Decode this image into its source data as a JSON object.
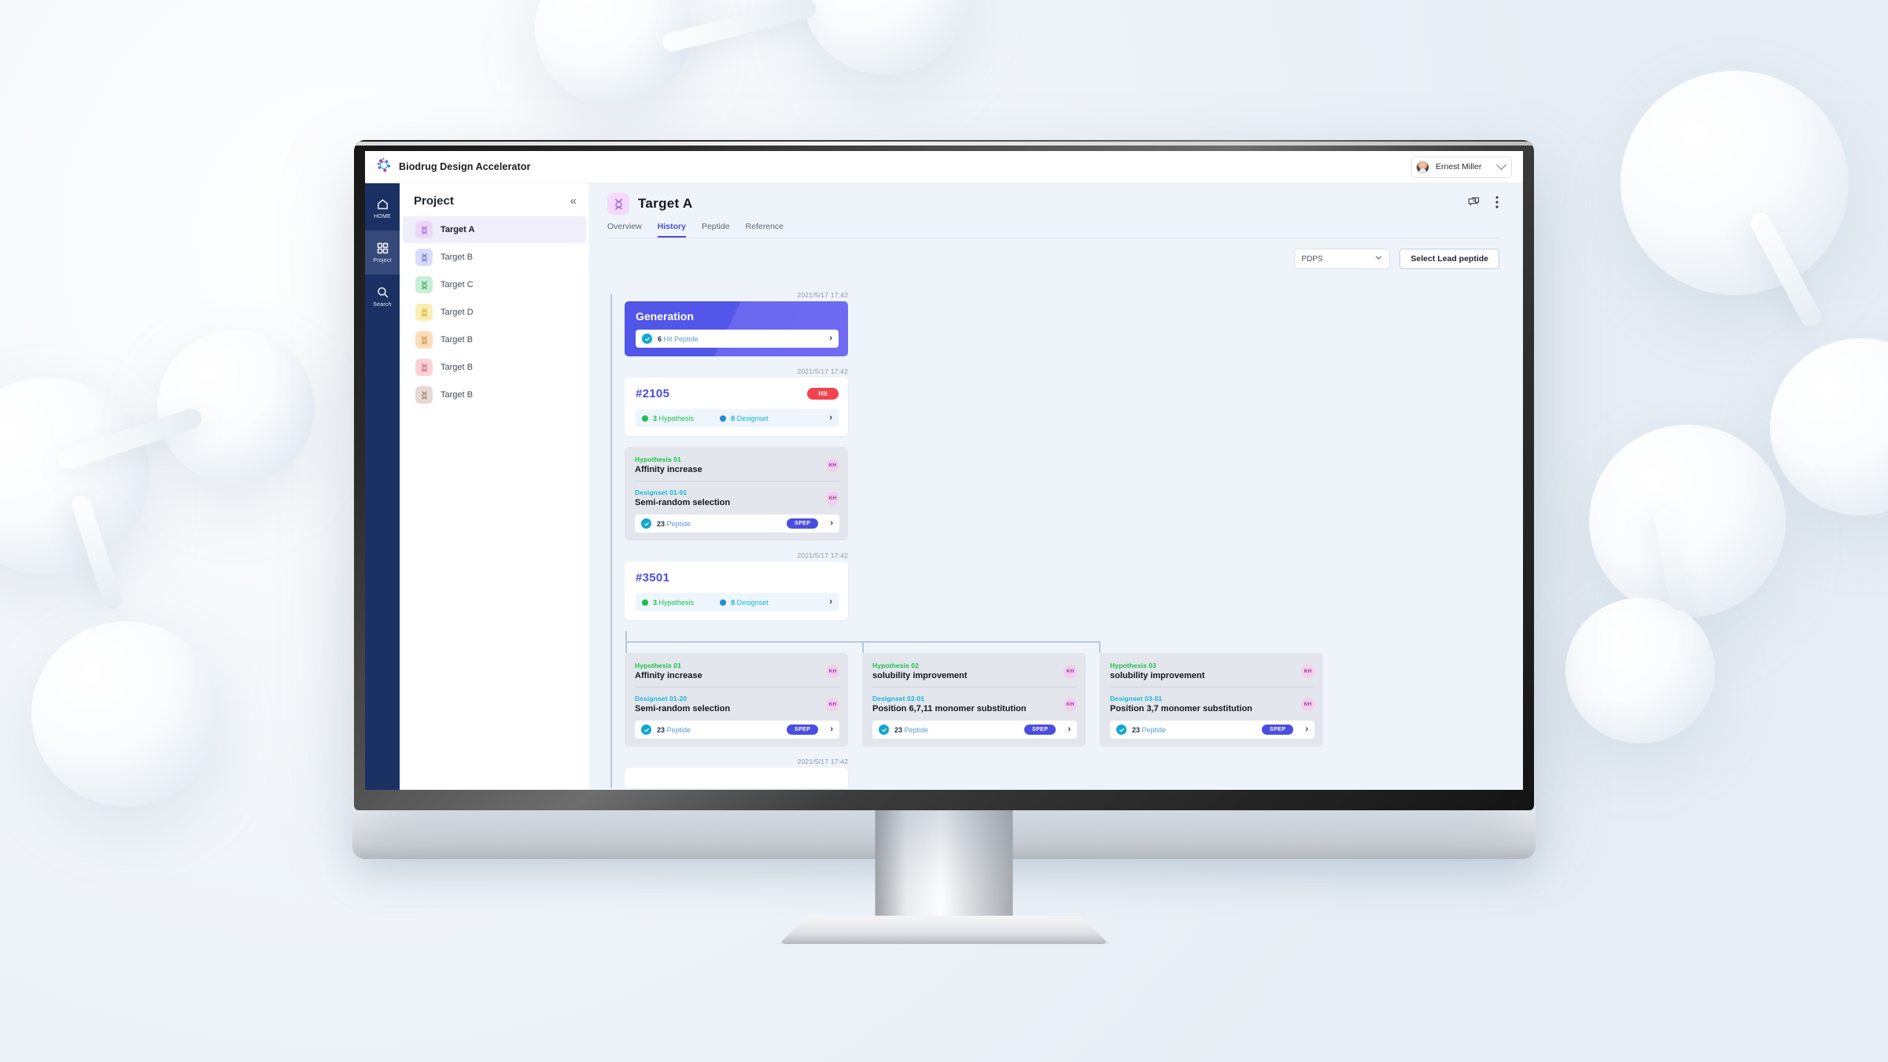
{
  "app": {
    "brand_name": "Biodrug Design Accelerator",
    "logo_icon": "molecule-logo-icon",
    "user": {
      "name": "Ernest Miller",
      "avatar_icon": "user-avatar",
      "caret_icon": "chevron-down-icon"
    }
  },
  "rail": {
    "items": [
      {
        "label": "HOME",
        "icon": "home-icon",
        "active": false
      },
      {
        "label": "Project",
        "icon": "grid-icon",
        "active": true
      },
      {
        "label": "Search",
        "icon": "search-icon",
        "active": false
      }
    ]
  },
  "projects": {
    "title": "Project",
    "collapse_icon": "chevrons-left-icon",
    "items": [
      {
        "label": "Target A",
        "color": "#edd6fb",
        "stroke": "#a765e0",
        "active": true
      },
      {
        "label": "Target B",
        "color": "#d9dcfb",
        "stroke": "#6b73dd",
        "active": false
      },
      {
        "label": "Target C",
        "color": "#c9f0d7",
        "stroke": "#3cab6a",
        "active": false
      },
      {
        "label": "Target D",
        "color": "#fbeeb4",
        "stroke": "#dfae2a",
        "active": false
      },
      {
        "label": "Target B",
        "color": "#fbddb9",
        "stroke": "#e08a38",
        "active": false
      },
      {
        "label": "Target B",
        "color": "#fbd2d8",
        "stroke": "#e0607a",
        "active": false
      },
      {
        "label": "Target B",
        "color": "#e8d9d3",
        "stroke": "#a58277",
        "active": false
      }
    ]
  },
  "header": {
    "target_title": "Target  A",
    "target_swatch_color": "#f4d9fb",
    "target_swatch_stroke": "#a765e0",
    "comment_icon": "comments-icon",
    "more_icon": "more-vertical-icon",
    "tabs": [
      {
        "label": "Overview",
        "active": false
      },
      {
        "label": "History",
        "active": true
      },
      {
        "label": "Peptide",
        "active": false
      },
      {
        "label": "Reference",
        "active": false
      }
    ]
  },
  "toolbar": {
    "select_value": "PDPS",
    "select_caret_icon": "chevron-down-icon",
    "lead_button": "Select Lead peptide"
  },
  "colors": {
    "accent": "#4a4ee0",
    "hit_badge": "#f1434e",
    "hypothesis_green": "#18c24a",
    "designset_cyan": "#16b6d8",
    "check_blue": "#11a7d1",
    "rail_navy": "#1b3163",
    "canvas": "#eef4fa"
  },
  "timeline": [
    {
      "kind": "generation",
      "timestamp": "2021/5/17  17:42",
      "title": "Generation",
      "peptide_count": "6",
      "peptide_label": "Hit Peptide",
      "check_icon": "check-circle-icon",
      "chevron_icon": "chevron-right-icon"
    },
    {
      "kind": "node",
      "timestamp": "2021/5/17  17:42",
      "number": "#2105",
      "badge": "Hit",
      "hypothesis_count": "3",
      "hypothesis_label": "Hypothesis",
      "designset_count": "8",
      "designset_label": "Designset",
      "chevron_icon": "chevron-right-icon"
    },
    {
      "kind": "hypothesis-card",
      "hypothesis_kicker": "Hypothesis 01",
      "hypothesis_name": "Affinity increase",
      "hypothesis_owner": "KH",
      "designset_kicker": "Designset 01-01",
      "designset_name": "Semi-random selection",
      "designset_owner": "KH",
      "peptide_count": "23",
      "peptide_label": "Peptide",
      "method_badge": "SPEP",
      "check_icon": "check-circle-icon",
      "chevron_icon": "chevron-right-icon"
    },
    {
      "kind": "node",
      "timestamp": "2021/5/17  17:42",
      "number": "#3501",
      "badge": "",
      "hypothesis_count": "3",
      "hypothesis_label": "Hypothesis",
      "designset_count": "8",
      "designset_label": "Designset",
      "chevron_icon": "chevron-right-icon"
    },
    {
      "kind": "branch-row",
      "cards": [
        {
          "hypothesis_kicker": "Hypothesis 01",
          "hypothesis_name": "Affinity increase",
          "hypothesis_owner": "KH",
          "designset_kicker": "Designset 01-20",
          "designset_name": "Semi-random selection",
          "designset_owner": "KH",
          "peptide_count": "23",
          "peptide_label": "Peptide",
          "method_badge": "SPEP"
        },
        {
          "hypothesis_kicker": "Hypothesis 02",
          "hypothesis_name": "solubility improvement",
          "hypothesis_owner": "KH",
          "designset_kicker": "Designset 02-01",
          "designset_name": "Position 6,7,11 monomer substitution",
          "designset_owner": "KH",
          "peptide_count": "23",
          "peptide_label": "Peptide",
          "method_badge": "SPEP"
        },
        {
          "hypothesis_kicker": "Hypothesis 03",
          "hypothesis_name": "solubility improvement",
          "hypothesis_owner": "KH",
          "designset_kicker": "Designset 03-01",
          "designset_name": "Position 3,7 monomer substitution",
          "designset_owner": "KH",
          "peptide_count": "23",
          "peptide_label": "Peptide",
          "method_badge": "SPEP"
        }
      ]
    },
    {
      "kind": "footer-stamp",
      "timestamp": "2021/5/17  17:42"
    }
  ]
}
